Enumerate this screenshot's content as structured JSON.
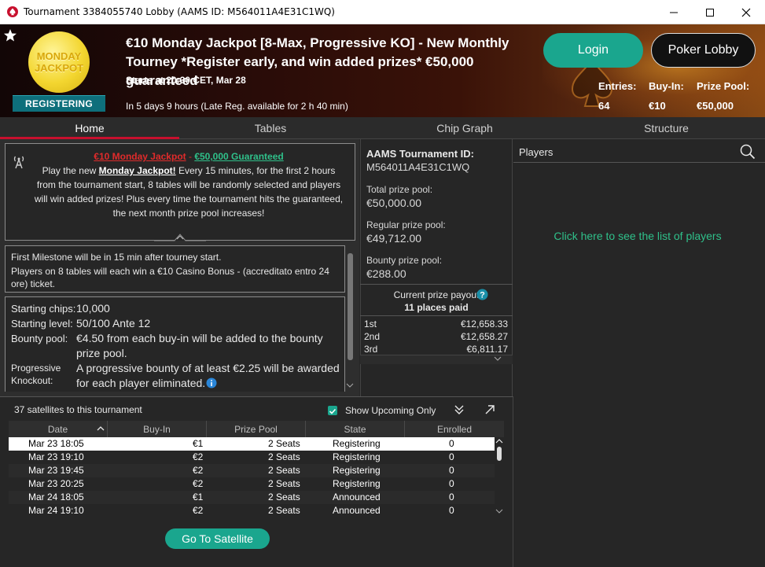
{
  "window": {
    "title": "Tournament 3384055740 Lobby (AAMS ID: M564011A4E31C1WQ)"
  },
  "header": {
    "badge_top": "MONDAY",
    "badge_bottom": "JACKPOT",
    "status": "REGISTERING",
    "title": "€10 Monday Jackpot [8-Max, Progressive KO] - New Monthly Tourney *Register early, and win added prizes* €50,000 guaranteed",
    "starts": "Starts at 20:30 CET, Mar 28",
    "in_time": "In 5 days 9 hours (Late Reg. available for 2 h 40 min)",
    "login_label": "Login",
    "lobby_label": "Poker Lobby",
    "entries_label": "Entries:",
    "entries_value": "64",
    "buyin_label": "Buy-In:",
    "buyin_value": "€10",
    "prizepool_label": "Prize Pool:",
    "prizepool_value": "€50,000"
  },
  "tabs": [
    "Home",
    "Tables",
    "Chip Graph",
    "Structure"
  ],
  "promo": {
    "title_red": "€10 Monday Jackpot",
    "title_sep": " - ",
    "title_green": "€50,000 Guaranteed",
    "line1_pre": "Play the new ",
    "line1_link": "Monday Jackpot!",
    "line1_post": " Every 15 minutes, for the first 2 hours from the tournament start, 8 tables will be randomly selected and players will win added prizes! Plus every time the tournament hits the guaranteed, the next month prize pool increases!"
  },
  "milestone": {
    "line1": "First Milestone will be in 15 min after tourney start.",
    "line2": "Players on 8 tables will each win a €10 Casino Bonus - (accreditato entro 24",
    "line3": "ore) ticket."
  },
  "details": {
    "chips_label": "Starting chips:",
    "chips_value": "10,000",
    "level_label": "Starting level:",
    "level_value": "50/100 Ante 12",
    "bounty_label": "Bounty pool:",
    "bounty_value_1": "€4.50 from each buy-in will be added to the bounty",
    "bounty_value_2": "prize pool.",
    "prog_label_1": "Progressive",
    "prog_label_2": "Knockout:",
    "prog_value_1": "A progressive bounty of at least €2.25 will be awarded",
    "prog_value_2": "for each player eliminated."
  },
  "aams": {
    "label": "AAMS Tournament ID:",
    "id": "M564011A4E31C1WQ",
    "total_label": "Total prize pool:",
    "total_value": "€50,000.00",
    "regular_label": "Regular prize pool:",
    "regular_value": "€49,712.00",
    "bounty_label": "Bounty prize pool:",
    "bounty_value": "€288.00"
  },
  "payout": {
    "header": "Current prize payout",
    "places": "11 places paid",
    "rows": [
      {
        "place": "1st",
        "amount": "€12,658.33"
      },
      {
        "place": "2nd",
        "amount": "€12,658.27"
      },
      {
        "place": "3rd",
        "amount": "€6,811.17"
      }
    ]
  },
  "players": {
    "header": "Players",
    "link": "Click here to see the list of players"
  },
  "satellites": {
    "count_label": "37 satellites to this tournament",
    "upcoming_label": "Show Upcoming Only",
    "columns": [
      "Date",
      "Buy-In",
      "Prize Pool",
      "State",
      "Enrolled"
    ],
    "rows": [
      {
        "date": "Mar 23  18:05",
        "buyin": "€1",
        "prize": "2 Seats",
        "state": "Registering",
        "enrolled": "0"
      },
      {
        "date": "Mar 23  19:10",
        "buyin": "€2",
        "prize": "2 Seats",
        "state": "Registering",
        "enrolled": "0"
      },
      {
        "date": "Mar 23  19:45",
        "buyin": "€2",
        "prize": "2 Seats",
        "state": "Registering",
        "enrolled": "0"
      },
      {
        "date": "Mar 23  20:25",
        "buyin": "€2",
        "prize": "2 Seats",
        "state": "Registering",
        "enrolled": "0"
      },
      {
        "date": "Mar 24  18:05",
        "buyin": "€1",
        "prize": "2 Seats",
        "state": "Announced",
        "enrolled": "0"
      },
      {
        "date": "Mar 24  19:10",
        "buyin": "€2",
        "prize": "2 Seats",
        "state": "Announced",
        "enrolled": "0"
      }
    ],
    "go_label": "Go To Satellite"
  },
  "colors": {
    "accent": "#1aa68e",
    "tab_active": "#c8102e",
    "promo_red": "#e02b2b",
    "promo_green": "#2fc08a",
    "players_link": "#2fc08a"
  },
  "icons": [
    "pokerstars-spade-icon",
    "minimize-icon",
    "maximize-icon",
    "close-icon",
    "star-icon",
    "antenna-icon",
    "info-icon",
    "help-icon",
    "search-icon",
    "collapse-icon",
    "popout-icon",
    "sort-up-icon",
    "chevron-down-icon"
  ]
}
